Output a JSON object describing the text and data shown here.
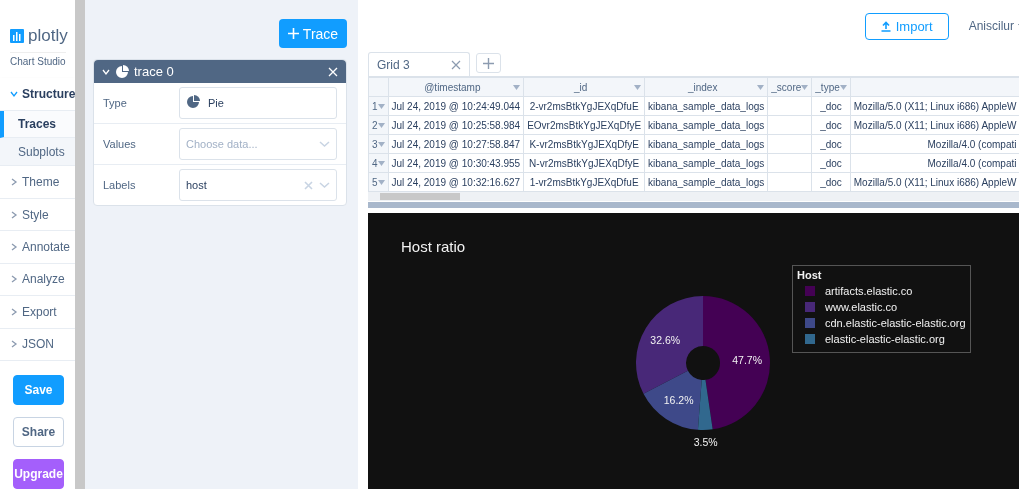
{
  "sidebar": {
    "logo": "plotly",
    "subtitle": "Chart Studio",
    "sections": [
      {
        "label": "Structure",
        "expanded": true,
        "children": [
          {
            "label": "Traces",
            "selected": true
          },
          {
            "label": "Subplots",
            "selected": false
          }
        ]
      },
      {
        "label": "Theme",
        "expanded": false
      },
      {
        "label": "Style",
        "expanded": false
      },
      {
        "label": "Annotate",
        "expanded": false
      },
      {
        "label": "Analyze",
        "expanded": false
      },
      {
        "label": "Export",
        "expanded": false
      },
      {
        "label": "JSON",
        "expanded": false
      }
    ],
    "buttons": [
      {
        "label": "Save",
        "kind": "primary"
      },
      {
        "label": "Share",
        "kind": "secondary"
      },
      {
        "label": "Upgrade",
        "kind": "upgrade"
      }
    ]
  },
  "panel": {
    "add_button": "Trace",
    "trace": {
      "title": "trace 0",
      "expanded": true,
      "fields": [
        {
          "label": "Type",
          "kind": "type",
          "value": "Pie"
        },
        {
          "label": "Values",
          "kind": "select",
          "placeholder": "Choose data..."
        },
        {
          "label": "Labels",
          "kind": "select",
          "value": "host",
          "clearable": true
        }
      ]
    }
  },
  "toolbar": {
    "import_button": "Import",
    "user_menu": "Aniscilur"
  },
  "grid": {
    "tabs": [
      {
        "label": "Grid 3",
        "selected": true
      }
    ],
    "columns": [
      "@timestamp",
      "_id",
      "_index",
      "_score",
      "_type"
    ],
    "rows": [
      {
        "number": "1",
        "cells": [
          "Jul 24, 2019 @ 10:24:49.044",
          "2-vr2msBtkYgJEXqDfuE",
          "kibana_sample_data_logs",
          "",
          "_doc",
          "Mozilla/5.0 (X11; Linux i686) AppleW"
        ]
      },
      {
        "number": "2",
        "cells": [
          "Jul 24, 2019 @ 10:25:58.984",
          "EOvr2msBtkYgJEXqDfyE",
          "kibana_sample_data_logs",
          "",
          "_doc",
          "Mozilla/5.0 (X11; Linux i686) AppleW"
        ]
      },
      {
        "number": "3",
        "cells": [
          "Jul 24, 2019 @ 10:27:58.847",
          "K-vr2msBtkYgJEXqDfyE",
          "kibana_sample_data_logs",
          "",
          "_doc",
          "Mozilla/4.0 (compati"
        ]
      },
      {
        "number": "4",
        "cells": [
          "Jul 24, 2019 @ 10:30:43.955",
          "N-vr2msBtkYgJEXqDfyE",
          "kibana_sample_data_logs",
          "",
          "_doc",
          "Mozilla/4.0 (compati"
        ]
      },
      {
        "number": "5",
        "cells": [
          "Jul 24, 2019 @ 10:32:16.627",
          "1-vr2msBtkYgJEXqDfuE",
          "kibana_sample_data_logs",
          "",
          "_doc",
          "Mozilla/5.0 (X11; Linux i686) AppleW"
        ]
      }
    ]
  },
  "chart": {
    "legend_title": "Host",
    "chart_data": {
      "type": "donut",
      "title": "Host ratio",
      "categories": [
        "artifacts.elastic.co",
        "www.elastic.co",
        "cdn.elastic-elastic-elastic.org",
        "elastic-elastic-elastic.org"
      ],
      "values": [
        47.7,
        32.6,
        16.2,
        3.5
      ],
      "value_labels": [
        "47.7%",
        "32.6%",
        "16.2%",
        "3.5%"
      ],
      "colors": [
        "#440154",
        "#482878",
        "#3e4989",
        "#31688e"
      ]
    }
  }
}
